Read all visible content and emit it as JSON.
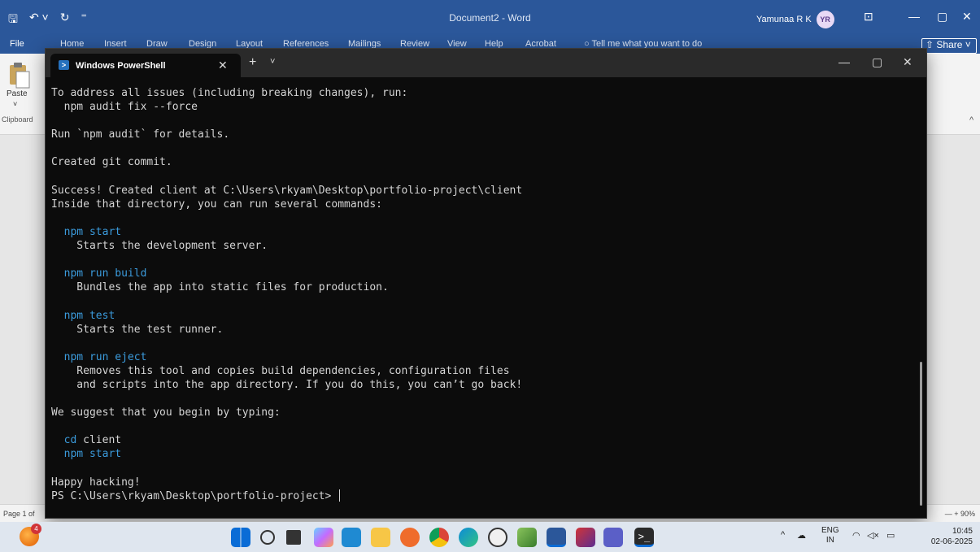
{
  "word": {
    "qat": {
      "save": "🖫",
      "undo": "↶ ˅",
      "redo": "↻",
      "more": "⁼"
    },
    "doc_title": "Document2 - Word",
    "user_name": "Yamunaa R K",
    "user_initials": "YR",
    "tabs": [
      "File",
      "Home",
      "Insert",
      "Draw",
      "Design",
      "Layout",
      "References",
      "Mailings",
      "Review",
      "View",
      "Help",
      "Acrobat",
      "Tell me what you want to do"
    ],
    "share_label": "Share",
    "paste_label": "Paste",
    "clipboard_label": "Clipboard",
    "status_page": "Page 1 of",
    "zoom": "90%"
  },
  "terminal": {
    "tab_title": "Windows PowerShell",
    "lines": [
      {
        "text": "To address all issues (including breaking changes), run:",
        "type": "normal"
      },
      {
        "text": "  npm audit fix --force",
        "type": "normal"
      },
      {
        "text": "",
        "type": "normal"
      },
      {
        "text": "Run `npm audit` for details.",
        "type": "normal"
      },
      {
        "text": "",
        "type": "normal"
      },
      {
        "text": "Created git commit.",
        "type": "normal"
      },
      {
        "text": "",
        "type": "normal"
      },
      {
        "text": "Success! Created client at C:\\Users\\rkyam\\Desktop\\portfolio-project\\client",
        "type": "normal"
      },
      {
        "text": "Inside that directory, you can run several commands:",
        "type": "normal"
      },
      {
        "text": "",
        "type": "normal"
      },
      {
        "text": "  npm start",
        "type": "cmd"
      },
      {
        "text": "    Starts the development server.",
        "type": "normal"
      },
      {
        "text": "",
        "type": "normal"
      },
      {
        "text": "  npm run build",
        "type": "cmd"
      },
      {
        "text": "    Bundles the app into static files for production.",
        "type": "normal"
      },
      {
        "text": "",
        "type": "normal"
      },
      {
        "text": "  npm test",
        "type": "cmd"
      },
      {
        "text": "    Starts the test runner.",
        "type": "normal"
      },
      {
        "text": "",
        "type": "normal"
      },
      {
        "text": "  npm run eject",
        "type": "cmd"
      },
      {
        "text": "    Removes this tool and copies build dependencies, configuration files",
        "type": "normal"
      },
      {
        "text": "    and scripts into the app directory. If you do this, you can’t go back!",
        "type": "normal"
      },
      {
        "text": "",
        "type": "normal"
      },
      {
        "text": "We suggest that you begin by typing:",
        "type": "normal"
      },
      {
        "text": "",
        "type": "normal"
      },
      {
        "text": "  cd",
        "type": "cmd",
        "rest": " client"
      },
      {
        "text": "  npm start",
        "type": "cmd"
      },
      {
        "text": "",
        "type": "normal"
      },
      {
        "text": "Happy hacking!",
        "type": "normal"
      },
      {
        "text": "PS C:\\Users\\rkyam\\Desktop\\portfolio-project> ",
        "type": "prompt"
      }
    ]
  },
  "taskbar": {
    "notification_count": "4",
    "lang": "ENG",
    "region": "IN",
    "time": "10:45",
    "date": "02-06-2025"
  },
  "colors": {
    "word_blue": "#2b579a",
    "terminal_bg": "#0c0c0c",
    "command_blue": "#3b9bdc"
  }
}
